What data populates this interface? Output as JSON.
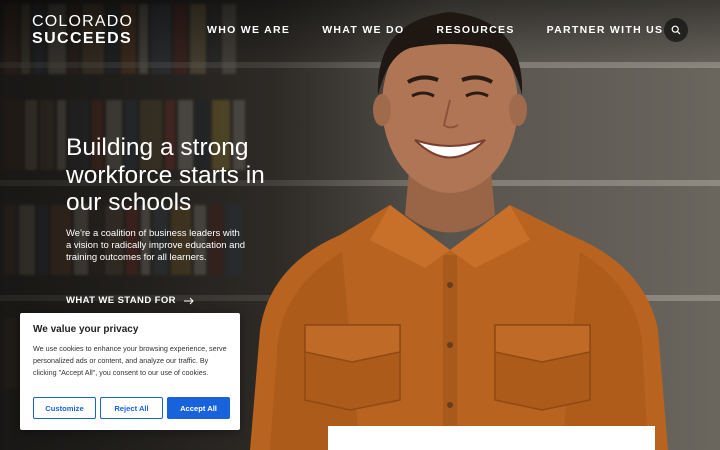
{
  "brand": {
    "line1": "COLORADO",
    "line2": "SUCCEEDS"
  },
  "nav": [
    {
      "label": "WHO WE ARE"
    },
    {
      "label": "WHAT WE DO"
    },
    {
      "label": "RESOURCES"
    },
    {
      "label": "PARTNER WITH US"
    }
  ],
  "search": {
    "icon": "search-icon"
  },
  "hero": {
    "title": "Building a strong workforce starts in our schools",
    "subtitle": "We're a coalition of business leaders with a vision to radically improve education and training outcomes for all learners.",
    "cta_label": "WHAT WE STAND FOR",
    "cta_icon": "arrow-right-icon"
  },
  "cookie_banner": {
    "title": "We value your privacy",
    "body": "We use cookies to enhance your browsing experience, serve personalized ads or content, and analyze our traffic. By clicking \"Accept All\", you consent to our use of cookies.",
    "customize_label": "Customize",
    "reject_label": "Reject All",
    "accept_label": "Accept All"
  },
  "colors": {
    "accent": "#1863dc",
    "shirt": "#b8631f",
    "logo_hat": "#e2a31b"
  }
}
